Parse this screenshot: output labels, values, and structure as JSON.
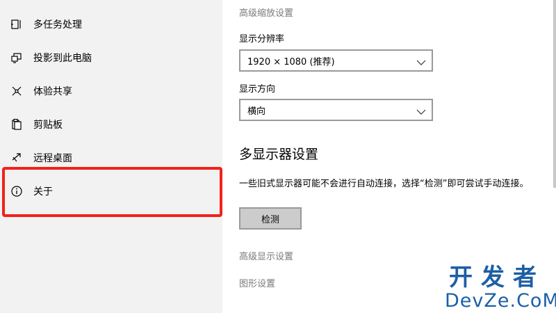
{
  "sidebar": {
    "items": [
      {
        "label": "多任务处理",
        "icon": "multitasking-icon"
      },
      {
        "label": "投影到此电脑",
        "icon": "projecting-icon"
      },
      {
        "label": "体验共享",
        "icon": "shared-experiences-icon"
      },
      {
        "label": "剪贴板",
        "icon": "clipboard-icon"
      },
      {
        "label": "远程桌面",
        "icon": "remote-desktop-icon"
      },
      {
        "label": "关于",
        "icon": "info-icon"
      }
    ],
    "highlight_color": "#f2211a"
  },
  "main": {
    "advanced_scaling_link": "高级缩放设置",
    "resolution": {
      "label": "显示分辨率",
      "value": "1920 × 1080 (推荐)"
    },
    "orientation": {
      "label": "显示方向",
      "value": "横向"
    },
    "multi_display": {
      "heading": "多显示器设置",
      "description": "一些旧式显示器可能不会进行自动连接，选择“检测”即可尝试手动连接。",
      "detect_button": "检测"
    },
    "advanced_display_link": "高级显示设置",
    "graphics_link": "图形设置"
  },
  "watermark": {
    "line1": "开发者",
    "line2": "DevZe.CoM",
    "color": "#1c5fa5"
  }
}
